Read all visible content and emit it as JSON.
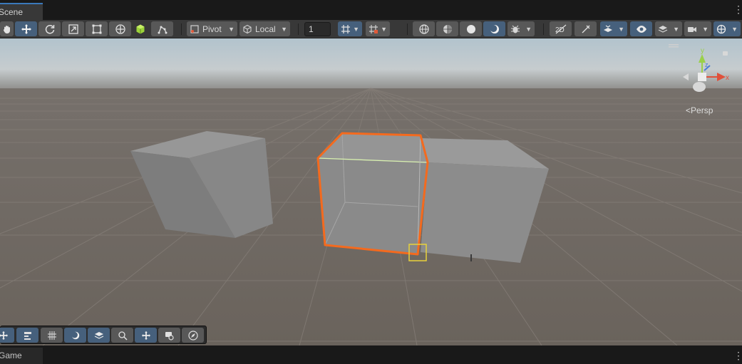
{
  "tabs": {
    "scene_label": "Scene",
    "game_label": "Game",
    "menu_icon": "kebab-menu-icon"
  },
  "toolbar": {
    "tools": [
      {
        "name": "hand-tool",
        "active": false
      },
      {
        "name": "move-tool",
        "active": true
      },
      {
        "name": "rotate-tool",
        "active": false
      },
      {
        "name": "scale-tool",
        "active": false
      },
      {
        "name": "rect-tool",
        "active": false
      },
      {
        "name": "transform-tool",
        "active": false
      },
      {
        "name": "custom-tool",
        "active": false
      },
      {
        "name": "probuilder-tool",
        "active": false
      }
    ],
    "pivot_label": "Pivot",
    "local_label": "Local",
    "grid_snap_value": "1",
    "shading_modes": [
      "wireframe",
      "shaded-wireframe",
      "shaded",
      "unlit"
    ],
    "active_shading": "unlit"
  },
  "viewport": {
    "projection_label": "Persp",
    "axes": {
      "y": "y",
      "x": "x",
      "z": "z"
    },
    "colors": {
      "sky_top": "#b4c5cf",
      "horizon": "#8d8b87",
      "ground": "#6e6760",
      "cube": "#8d8d8d",
      "selection_outline": "#f46a1e",
      "pivot_marker": "#e8d13a"
    }
  },
  "overlay_toolbar": {
    "buttons": [
      "move-overlay",
      "transform-tools",
      "grid-overlay",
      "shading-overlay",
      "layers-overlay",
      "search-overlay",
      "move-view",
      "camera-overlay",
      "compass-overlay"
    ]
  }
}
